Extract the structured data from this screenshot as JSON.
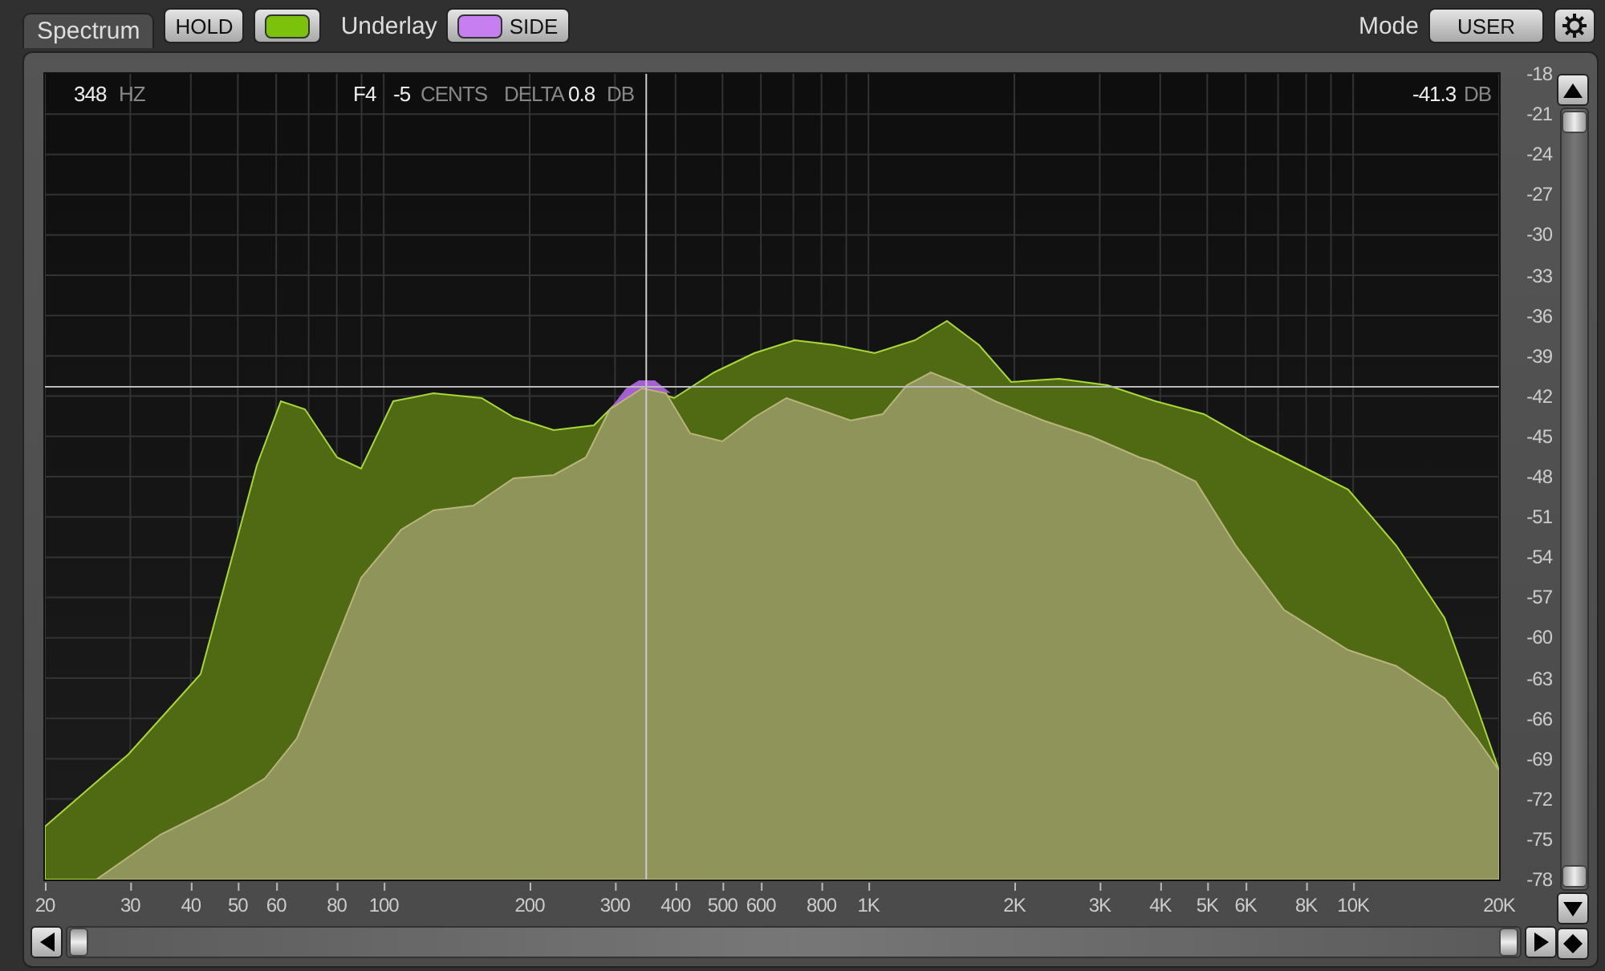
{
  "tab": {
    "label": "Spectrum",
    "selected": true
  },
  "hold": {
    "label": "HOLD",
    "color": "#7cc20c"
  },
  "underlay": {
    "label": "Underlay",
    "button": "SIDE",
    "color": "#c77ef0"
  },
  "mode": {
    "label": "Mode",
    "value": "USER"
  },
  "readout": {
    "frequency": "348",
    "frequency_unit": "HZ",
    "note": "F4",
    "cents": "-5",
    "cents_unit": "CENTS",
    "delta_label": "DELTA",
    "delta": "0.8",
    "delta_unit": "DB",
    "magnitude": "-41.3",
    "magnitude_unit": "DB"
  },
  "frequency_axis": [
    "20",
    "30",
    "40",
    "50",
    "60",
    "80",
    "100",
    "200",
    "300",
    "400",
    "500",
    "600",
    "800",
    "1K",
    "2K",
    "3K",
    "4K",
    "5K",
    "6K",
    "8K",
    "10K",
    "20K"
  ],
  "db_axis": [
    "-18",
    "-21",
    "-24",
    "-27",
    "-30",
    "-33",
    "-36",
    "-39",
    "-42",
    "-45",
    "-48",
    "-51",
    "-54",
    "-57",
    "-60",
    "-63",
    "-66",
    "-69",
    "-72",
    "-75",
    "-78"
  ]
}
